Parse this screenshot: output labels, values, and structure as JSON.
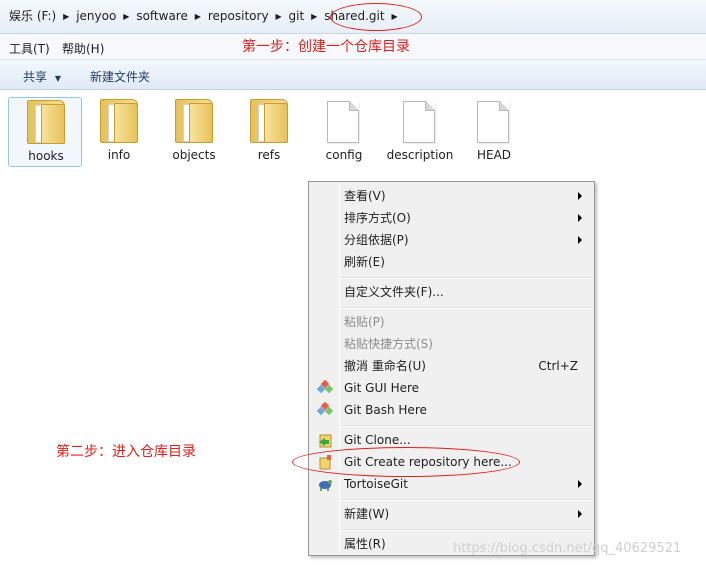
{
  "breadcrumb": [
    "娱乐 (F:)",
    "jenyoo",
    "software",
    "repository",
    "git",
    "shared.git"
  ],
  "annotations": {
    "step1": "第一步：创建一个仓库目录",
    "step2": "第二步：进入仓库目录"
  },
  "menubar": {
    "tools": "工具(T)",
    "help": "帮助(H)"
  },
  "commands": {
    "share": "共享",
    "share_arrow": "▼",
    "new_folder": "新建文件夹"
  },
  "files": [
    {
      "name": "hooks",
      "kind": "folder"
    },
    {
      "name": "info",
      "kind": "folder"
    },
    {
      "name": "objects",
      "kind": "folder"
    },
    {
      "name": "refs",
      "kind": "folder"
    },
    {
      "name": "config",
      "kind": "file"
    },
    {
      "name": "description",
      "kind": "file"
    },
    {
      "name": "HEAD",
      "kind": "file"
    }
  ],
  "context_menu": {
    "view": "查看(V)",
    "sort": "排序方式(O)",
    "group": "分组依据(P)",
    "refresh": "刷新(E)",
    "customize": "自定义文件夹(F)...",
    "paste": "粘贴(P)",
    "paste_shortcut": "粘贴快捷方式(S)",
    "undo_rename": "撤消 重命名(U)",
    "undo_shortcut": "Ctrl+Z",
    "git_gui": "Git GUI Here",
    "git_bash": "Git Bash Here",
    "git_clone": "Git Clone...",
    "git_create": "Git Create repository here...",
    "tortoisegit": "TortoiseGit",
    "new": "新建(W)",
    "properties": "属性(R)"
  },
  "icons": {
    "git_gui": "git-gui-icon",
    "git_bash": "git-bash-icon",
    "git_clone": "git-clone-icon",
    "git_create": "git-create-repo-icon",
    "tortoisegit": "tortoisegit-icon"
  },
  "watermark": "https://blog.csdn.net/qq_40629521",
  "colors": {
    "annotation": "#e0201c",
    "menu_bg": "#f0f0f0",
    "disabled_text": "#8d8d8d"
  }
}
